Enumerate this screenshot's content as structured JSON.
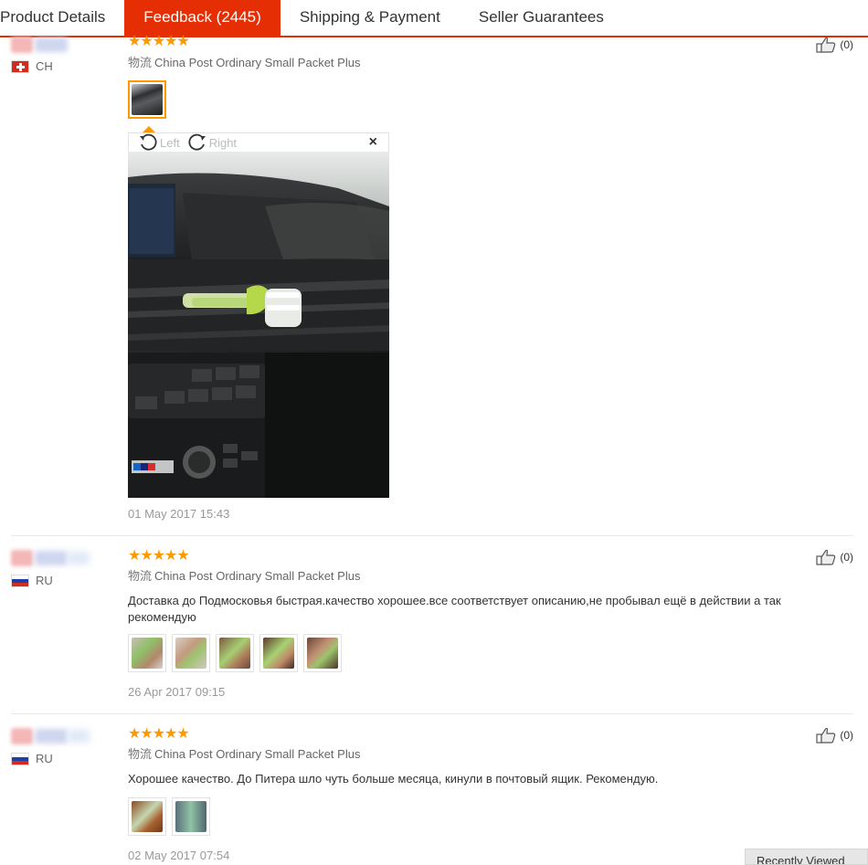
{
  "tabs": [
    {
      "label": "Product Details"
    },
    {
      "label": "Feedback (2445)"
    },
    {
      "label": "Shipping & Payment"
    },
    {
      "label": "Seller Guarantees"
    }
  ],
  "reviews": [
    {
      "country": "CH",
      "stars": "★★★★★",
      "logistics_cn": "物流",
      "logistics": "China Post Ordinary Small Packet Plus",
      "text": "",
      "date": "01 May 2017 15:43",
      "likes": "(0)"
    },
    {
      "country": "RU",
      "stars": "★★★★★",
      "logistics_cn": "物流",
      "logistics": "China Post Ordinary Small Packet Plus",
      "text": "Доставка до Подмосковья быстрая.качество хорошее.все соответствует описанию,не пробывал ещё в действии а так рекомендую",
      "date": "26 Apr 2017 09:15",
      "likes": "(0)"
    },
    {
      "country": "RU",
      "stars": "★★★★★",
      "logistics_cn": "物流",
      "logistics": "China Post Ordinary Small Packet Plus",
      "text": "Хорошее качество. До Питера шло чуть больше месяца, кинули в почтовый ящик. Рекомендую.",
      "date": "02 May 2017 07:54",
      "likes": "(0)"
    }
  ],
  "viewer": {
    "rotate_left": "Left",
    "rotate_right": "Right",
    "close": "×"
  },
  "recent": {
    "label": "Recently Viewed"
  },
  "colors": {
    "accent": "#e62e04",
    "star": "#ff9900"
  },
  "icons": [
    "thumbs-up-icon",
    "rotate-left-icon",
    "rotate-right-icon",
    "close-icon"
  ]
}
